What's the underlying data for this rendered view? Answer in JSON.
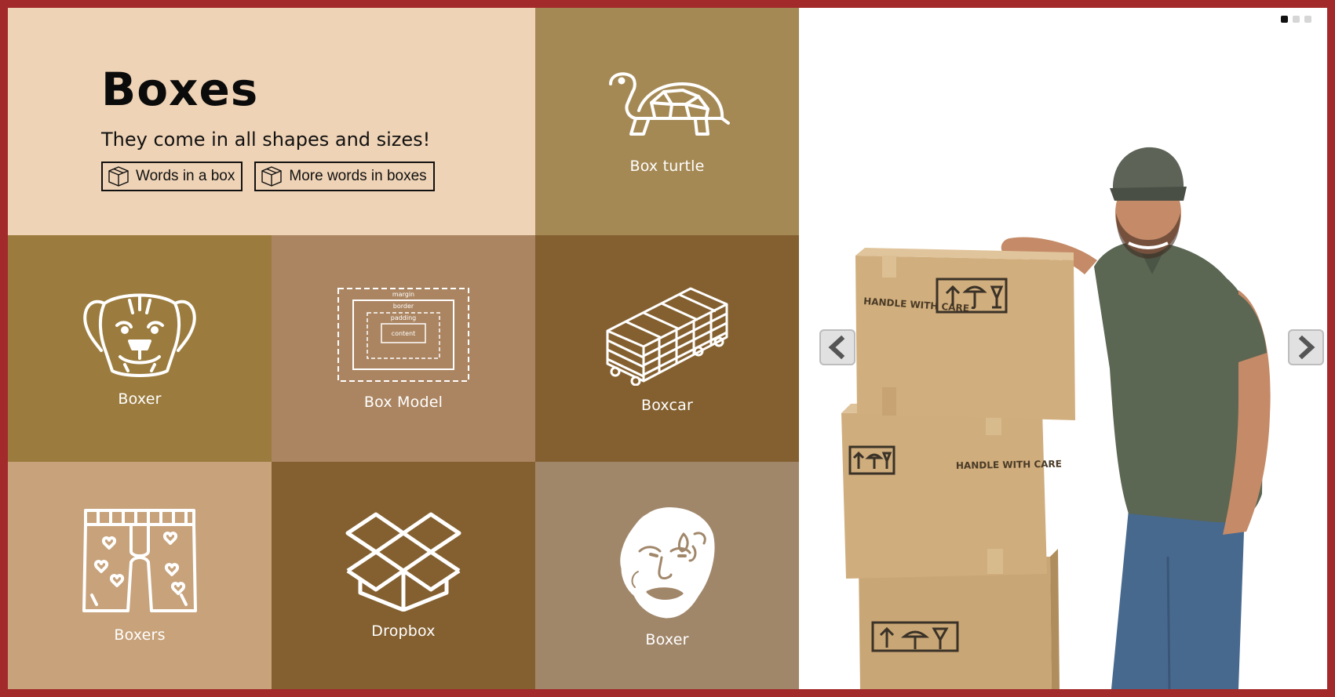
{
  "hero": {
    "title": "Boxes",
    "subtitle": "They come in all shapes and sizes!",
    "buttons": [
      {
        "label": "Words in a box",
        "icon": "box-icon"
      },
      {
        "label": "More words in boxes",
        "icon": "box-icon"
      }
    ]
  },
  "tiles": [
    {
      "label": "Box turtle",
      "icon": "turtle-icon",
      "color": "#a58955"
    },
    {
      "label": "Boxer",
      "icon": "boxer-dog-icon",
      "color": "#9c7c3e"
    },
    {
      "label": "Box Model",
      "icon": "box-model-icon",
      "color": "#ab8561",
      "box_model_layers": [
        "margin",
        "border",
        "padding",
        "content"
      ]
    },
    {
      "label": "Boxcar",
      "icon": "boxcar-icon",
      "color": "#846030"
    },
    {
      "label": "Boxers",
      "icon": "boxer-shorts-icon",
      "color": "#c7a27a"
    },
    {
      "label": "Dropbox",
      "icon": "dropbox-icon",
      "color": "#846030"
    },
    {
      "label": "Boxer",
      "icon": "boxer-face-icon",
      "color": "#a1876a"
    }
  ],
  "carousel": {
    "slide_count": 3,
    "active_slide": 1,
    "box_labels": [
      "HANDLE WITH CARE",
      "HANDLE WITH CARE"
    ],
    "prev_icon": "chevron-left-icon",
    "next_icon": "chevron-right-icon"
  },
  "colors": {
    "frame": "#a32a2a",
    "hero": "#efd3b6"
  }
}
